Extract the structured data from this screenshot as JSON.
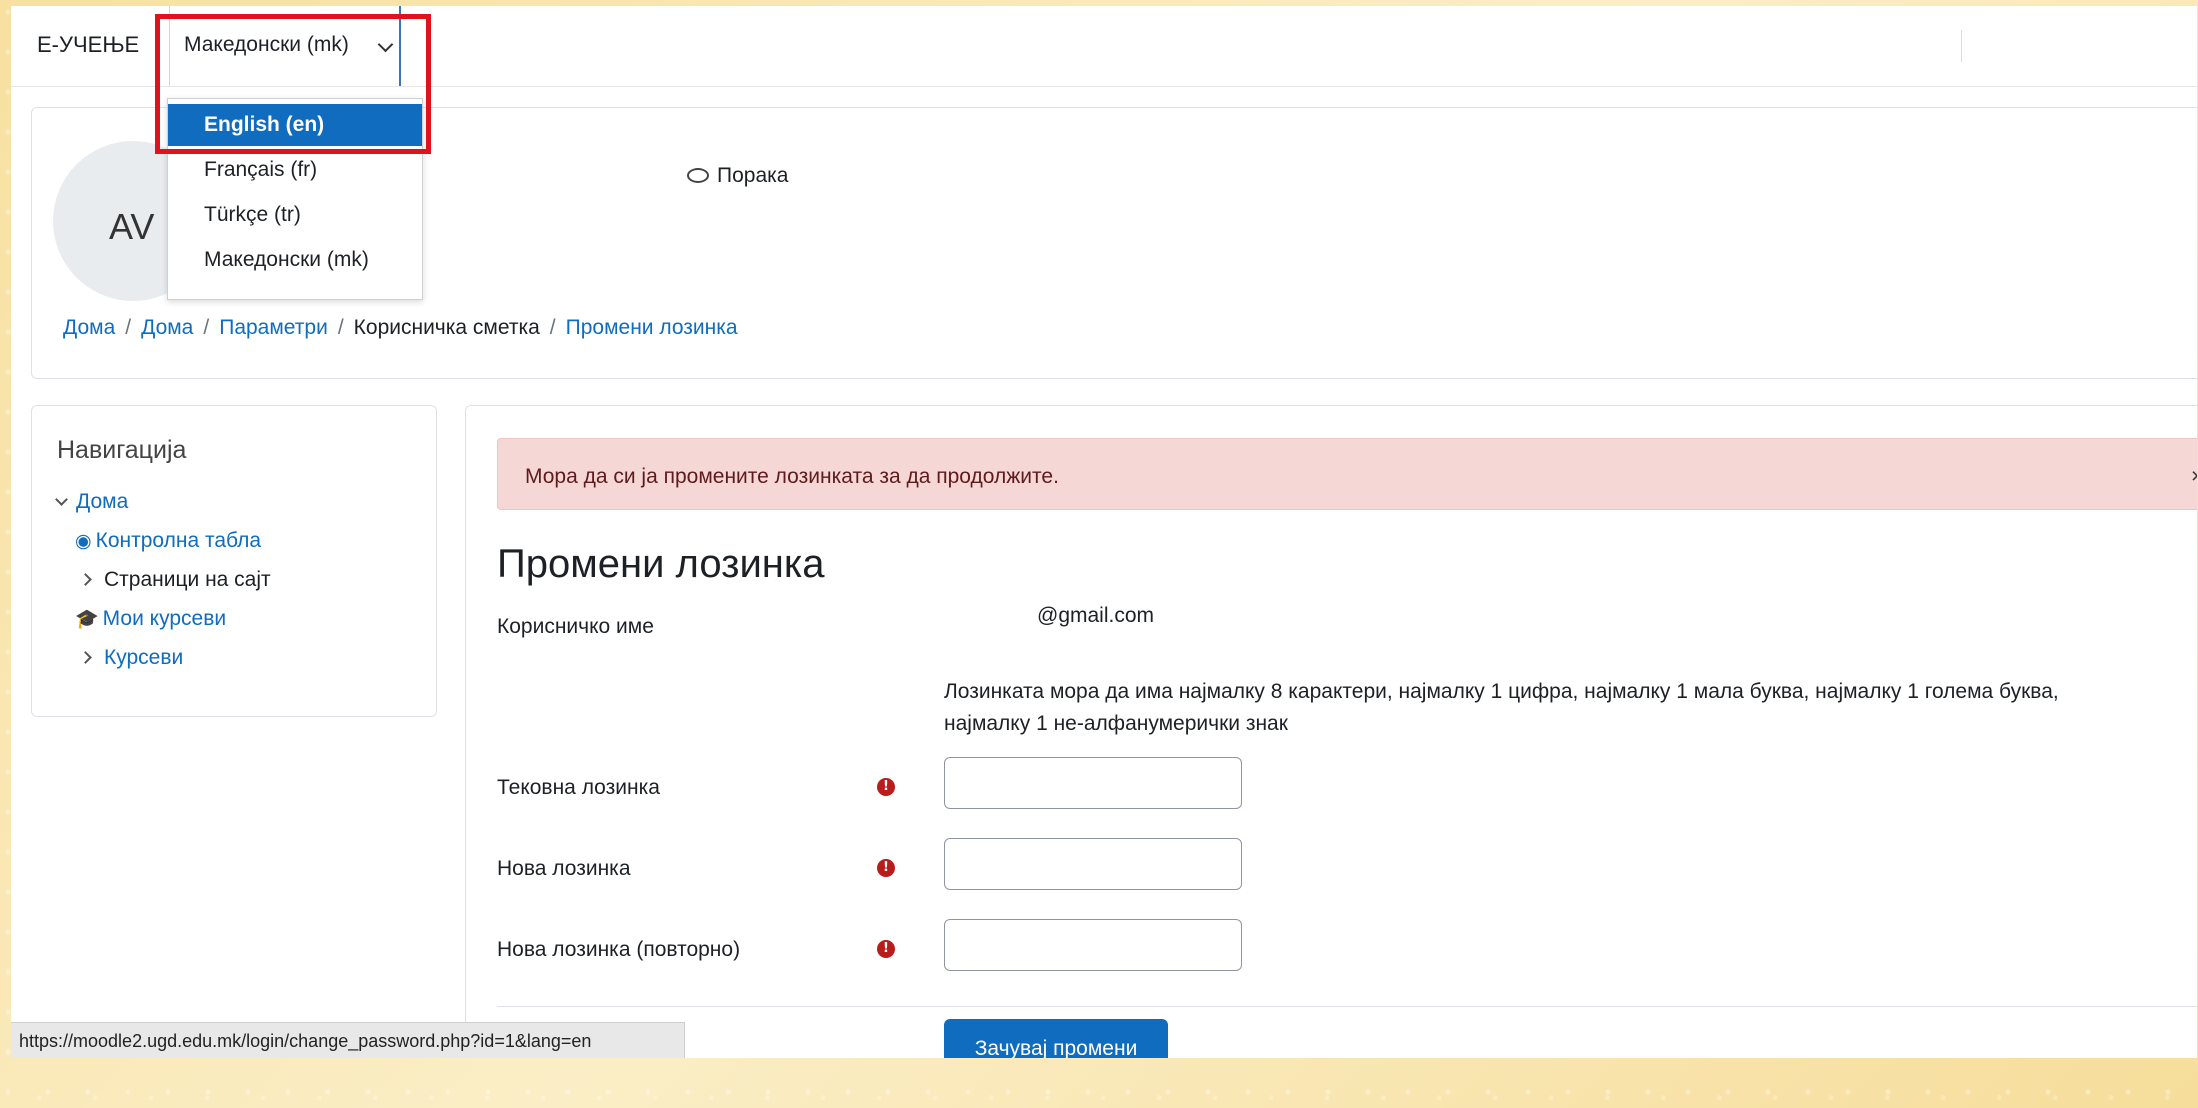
{
  "navbar": {
    "brand": "Е-УЧЕЊЕ",
    "language_current": "Македонски (mk)"
  },
  "language_menu": {
    "items": [
      "English (en)",
      "Français (fr)",
      "Türkçe (tr)",
      "Македонски (mk)"
    ],
    "active_index": 0
  },
  "profile": {
    "avatar_initials": "AV",
    "message_label": "Порака"
  },
  "breadcrumb": {
    "items": [
      "Дома",
      "Дома",
      "Параметри",
      "Корисничка сметка",
      "Промени лозинка"
    ],
    "separator": "/"
  },
  "navigation": {
    "title": "Навигација",
    "home": "Дома",
    "dashboard": "Контролна табла",
    "site_pages": "Страници на сајт",
    "my_courses": "Мои курсеви",
    "courses": "Курсеви"
  },
  "alert": {
    "text": "Мора да си ја промените лозинката за да продолжите.",
    "close": "×"
  },
  "form": {
    "heading": "Промени лозинка",
    "username_label": "Корисничко име",
    "username_value": "@gmail.com",
    "password_rules": "Лозинката мора да има најмалку 8 карактери, најмалку 1 цифра, најмалку 1 мала буква, најмалку 1 голема буква, најмалку 1 не-алфанумерички знак",
    "current_password_label": "Тековна лозинка",
    "new_password_label": "Нова лозинка",
    "new_password_repeat_label": "Нова лозинка (повторно)",
    "required_icon": "!",
    "save_label": "Зачувај промени"
  },
  "status_bar": {
    "url": "https://moodle2.ugd.edu.mk/login/change_password.php?id=1&lang=en"
  },
  "colors": {
    "accent": "#0f6cbf",
    "highlight": "#e0121b",
    "alert_bg": "#f5d7d6",
    "required": "#b91c1c"
  }
}
